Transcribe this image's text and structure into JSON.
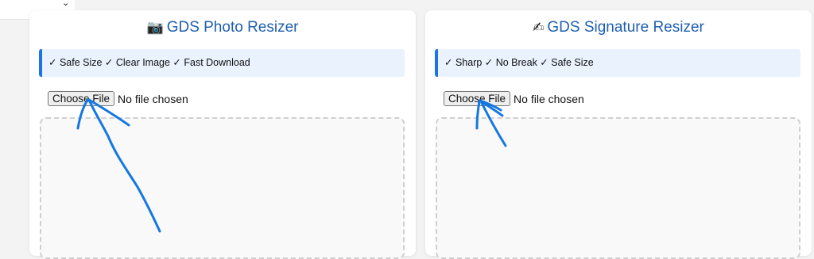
{
  "top_select": {
    "chevron_icon": "chevron-down-icon"
  },
  "photo_tool": {
    "icon": "camera-icon",
    "emoji": "📷",
    "title": "GDS Photo Resizer",
    "features": "✓ Safe Size ✓ Clear Image ✓ Fast Download",
    "file_button": "Choose File",
    "file_status": "No file chosen"
  },
  "signature_tool": {
    "icon": "writing-hand-icon",
    "emoji": "✍",
    "title": "GDS Signature Resizer",
    "features": "✓ Sharp ✓ No Break ✓ Safe Size",
    "file_button": "Choose File",
    "file_status": "No file chosen"
  },
  "colors": {
    "accent": "#1a73e8",
    "title": "#1f5fb0",
    "annotation": "#1677e0"
  }
}
